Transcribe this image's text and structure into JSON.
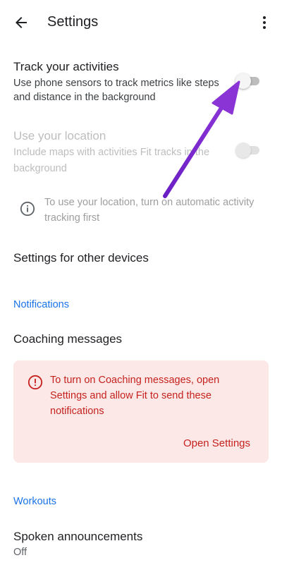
{
  "appbar": {
    "title": "Settings",
    "back_icon": "arrow-back-icon",
    "more_icon": "more-vert-icon"
  },
  "track": {
    "title": "Track your activities",
    "description": "Use phone sensors to track metrics like steps and distance in the background",
    "enabled": false
  },
  "location": {
    "title": "Use your location",
    "description": "Include maps with activities Fit tracks in the background",
    "enabled": false,
    "disabled": true
  },
  "location_info": {
    "icon": "info-icon",
    "text": "To use your location, turn on automatic activity tracking first"
  },
  "other_devices": {
    "title": "Settings for other devices"
  },
  "notifications": {
    "header": "Notifications",
    "coaching_title": "Coaching messages",
    "alert_text": "To turn on Coaching messages, open Settings and allow Fit to send these notifications",
    "alert_button": "Open Settings",
    "alert_icon": "error-icon"
  },
  "workouts": {
    "header": "Workouts",
    "spoken_title": "Spoken announcements",
    "spoken_value": "Off"
  },
  "colors": {
    "accent": "#1a73e8",
    "error": "#c5221f",
    "error_bg": "#fce8e6",
    "annotation_arrow": "#7b2cc9"
  }
}
